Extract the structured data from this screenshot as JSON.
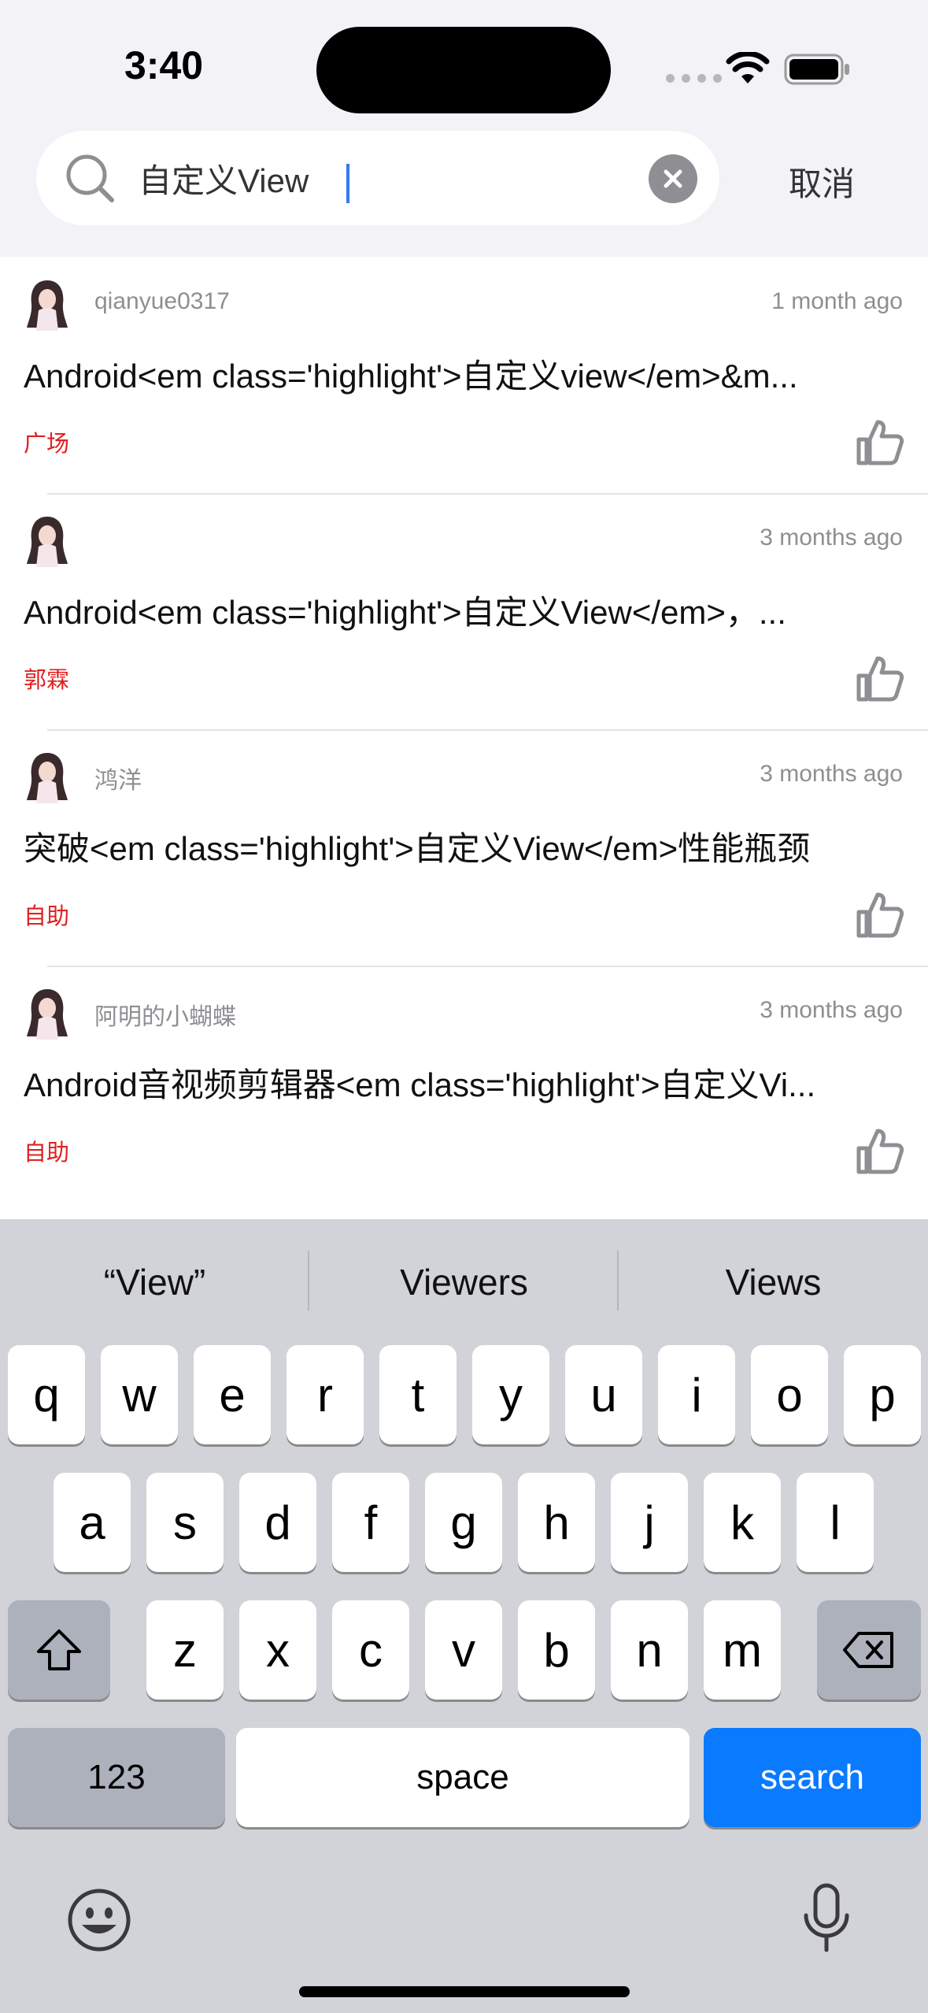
{
  "status_bar": {
    "time": "3:40"
  },
  "search": {
    "query": "自定义View",
    "cancel_label": "取消"
  },
  "results": [
    {
      "author": "qianyue0317",
      "time": "1 month ago",
      "title": "Android<em class='highlight'>自定义view</em>&m...",
      "tag": "广场"
    },
    {
      "author": "",
      "time": "3 months ago",
      "title": "Android<em class='highlight'>自定义View</em>，...",
      "tag": "郭霖"
    },
    {
      "author": "鸿洋",
      "time": "3 months ago",
      "title": "突破<em class='highlight'>自定义View</em>性能瓶颈",
      "tag": "自助"
    },
    {
      "author": "阿明的小蝴蝶",
      "time": "3 months ago",
      "title": "Android音视频剪辑器<em class='highlight'>自定义Vi...",
      "tag": "自助"
    }
  ],
  "keyboard": {
    "suggestions": [
      "“View”",
      "Viewers",
      "Views"
    ],
    "row1": [
      "q",
      "w",
      "e",
      "r",
      "t",
      "y",
      "u",
      "i",
      "o",
      "p"
    ],
    "row2": [
      "a",
      "s",
      "d",
      "f",
      "g",
      "h",
      "j",
      "k",
      "l"
    ],
    "row3": [
      "z",
      "x",
      "c",
      "v",
      "b",
      "n",
      "m"
    ],
    "numbers_label": "123",
    "space_label": "space",
    "search_label": "search"
  },
  "colors": {
    "accent": "#0a7aff",
    "tag": "#e02020",
    "secondary_text": "#8e8e93"
  }
}
